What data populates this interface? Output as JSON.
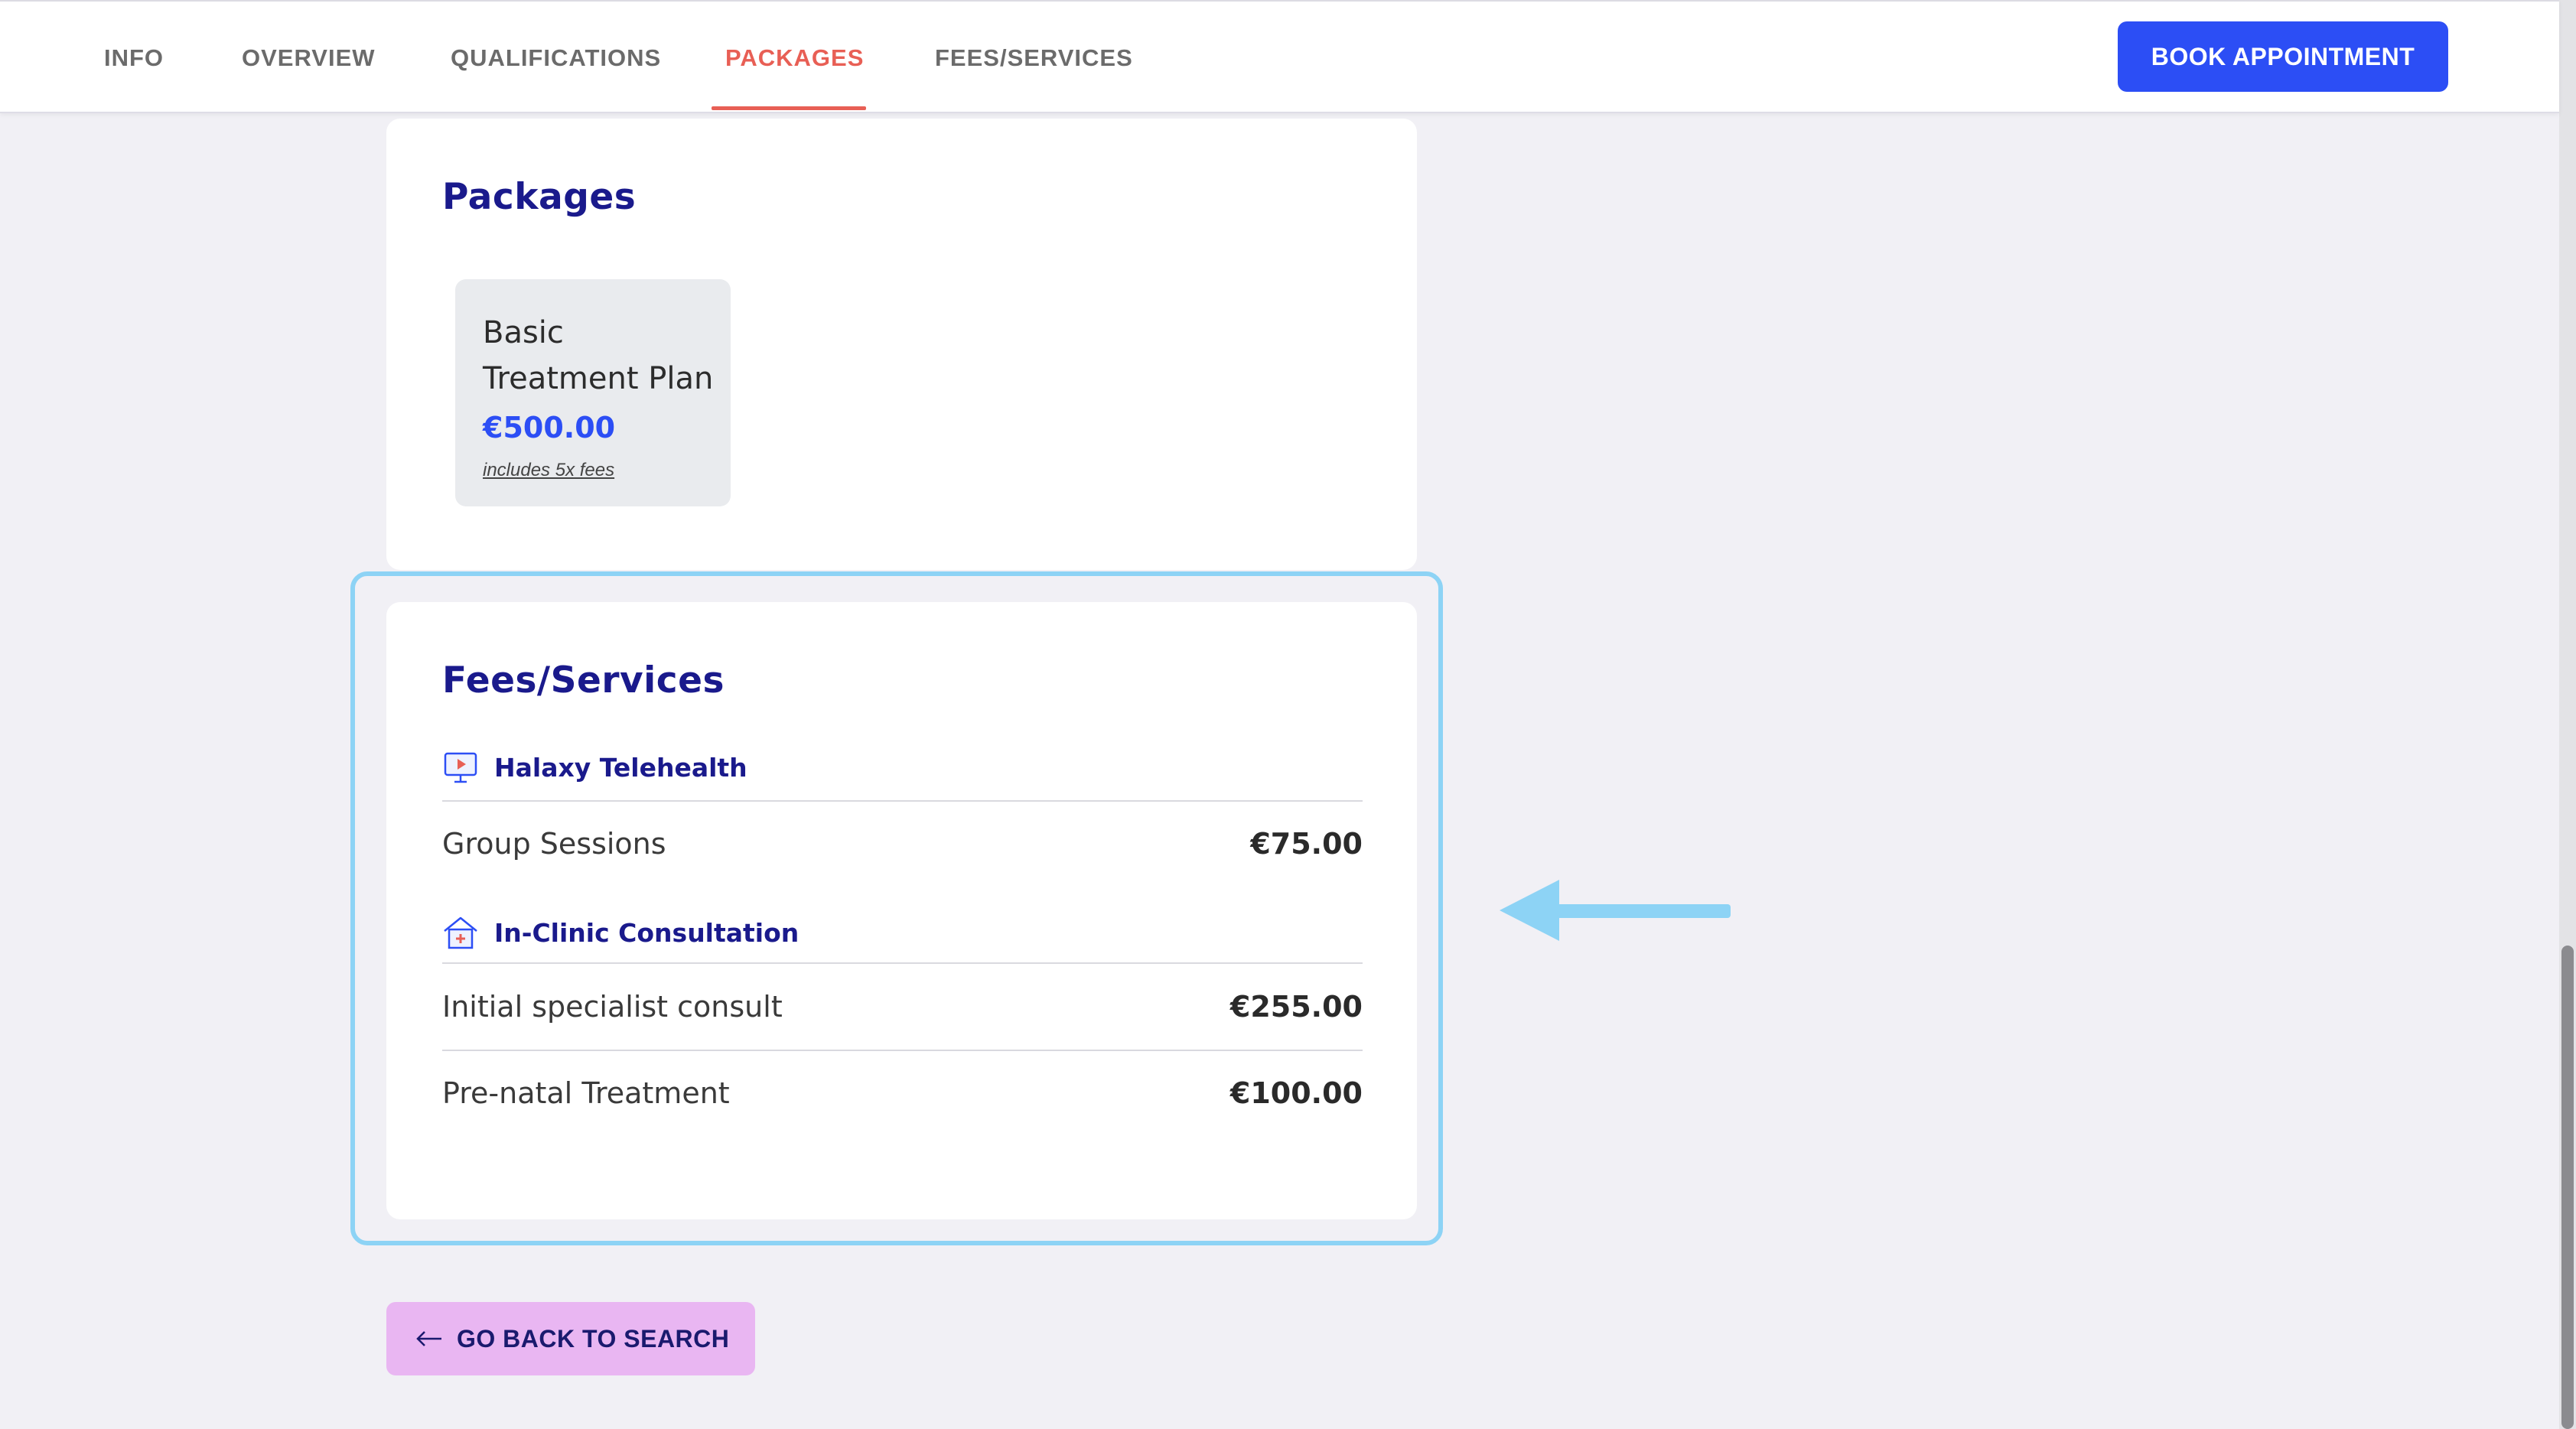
{
  "nav": {
    "tabs": [
      {
        "label": "INFO"
      },
      {
        "label": "OVERVIEW"
      },
      {
        "label": "QUALIFICATIONS"
      },
      {
        "label": "PACKAGES",
        "active": true
      },
      {
        "label": "FEES/SERVICES"
      }
    ],
    "book_label": "BOOK APPOINTMENT"
  },
  "packages": {
    "title": "Packages",
    "items": [
      {
        "name": "Basic Treatment Plan",
        "price": "€500.00",
        "note": "includes 5x fees"
      }
    ]
  },
  "fees": {
    "title": "Fees/Services",
    "groups": [
      {
        "name": "Halaxy Telehealth",
        "icon": "telehealth-screen-icon",
        "items": [
          {
            "name": "Group Sessions",
            "price": "€75.00"
          }
        ]
      },
      {
        "name": "In-Clinic Consultation",
        "icon": "clinic-house-icon",
        "items": [
          {
            "name": "Initial specialist consult",
            "price": "€255.00"
          },
          {
            "name": "Pre-natal Treatment",
            "price": "€100.00"
          }
        ]
      }
    ]
  },
  "back_label": "GO BACK TO SEARCH",
  "colors": {
    "accent": "#2c4ef5",
    "active_tab": "#e85f55",
    "title": "#1a1a8c",
    "highlight": "#8dd3f5",
    "back_button": "#e9b6f2"
  }
}
